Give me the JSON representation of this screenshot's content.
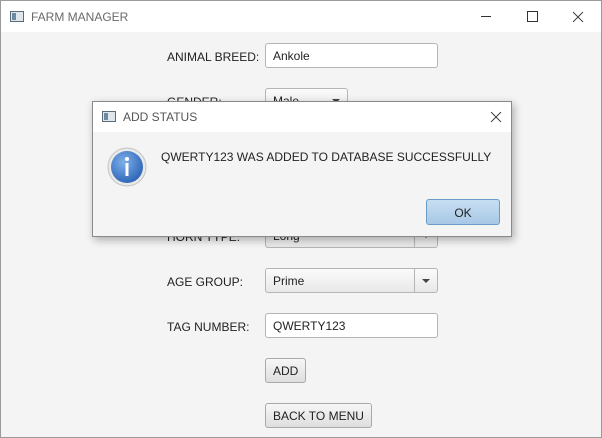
{
  "window": {
    "title": "FARM MANAGER"
  },
  "form": {
    "breed_label": "ANIMAL BREED:",
    "breed_value": "Ankole",
    "gender_label": "GENDER:",
    "gender_value": "Male",
    "horn_label": "HORN TYPE:",
    "horn_value": "Long",
    "age_label": "AGE GROUP:",
    "age_value": "Prime",
    "tag_label": "TAG NUMBER:",
    "tag_value": "QWERTY123",
    "add_label": "ADD",
    "back_label": "BACK TO MENU"
  },
  "dialog": {
    "title": "ADD STATUS",
    "message": "QWERTY123 WAS ADDED TO DATABASE SUCCESSFULLY",
    "ok_label": "OK",
    "icon": "info-icon"
  },
  "colors": {
    "accent": "#3b78c6",
    "ok_button": "#b6d3ee"
  }
}
